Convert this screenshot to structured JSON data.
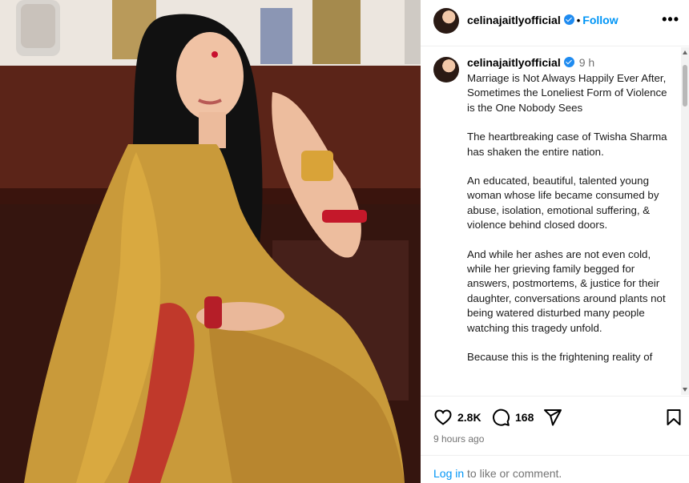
{
  "post": {
    "image_alt": "Woman in gold silk saree with red bindi and bangles",
    "username": "celinajaitlyofficial",
    "follow_label": "Follow",
    "separator": "•",
    "more_label": "•••",
    "time": "9 h",
    "caption": [
      "Marriage is Not Always Happily Ever After, Sometimes the Loneliest Form of Violence is the One Nobody Sees",
      "The heartbreaking case of Twisha Sharma has shaken the entire nation.",
      "An educated, beautiful, talented young woman whose life became consumed by abuse, isolation, emotional suffering, & violence behind closed doors.",
      "And while her ashes are not even cold, while her grieving family begged for answers, postmortems, & justice for their daughter, conversations around plants not being watered disturbed many people watching this tragedy unfold.",
      "Because this is the frightening reality of"
    ],
    "likes": "2.8K",
    "comments": "168",
    "posted_ago": "9 hours ago"
  },
  "footer": {
    "login_label": "Log in",
    "rest_label": "to like or comment."
  },
  "icons": {
    "like": "heart-icon",
    "comment": "comment-icon",
    "share": "share-icon",
    "save": "bookmark-icon",
    "more": "more-icon",
    "verified": "verified-icon"
  },
  "colors": {
    "accent": "#0095f6",
    "verified": "#1f8bf0",
    "muted": "#737373"
  }
}
